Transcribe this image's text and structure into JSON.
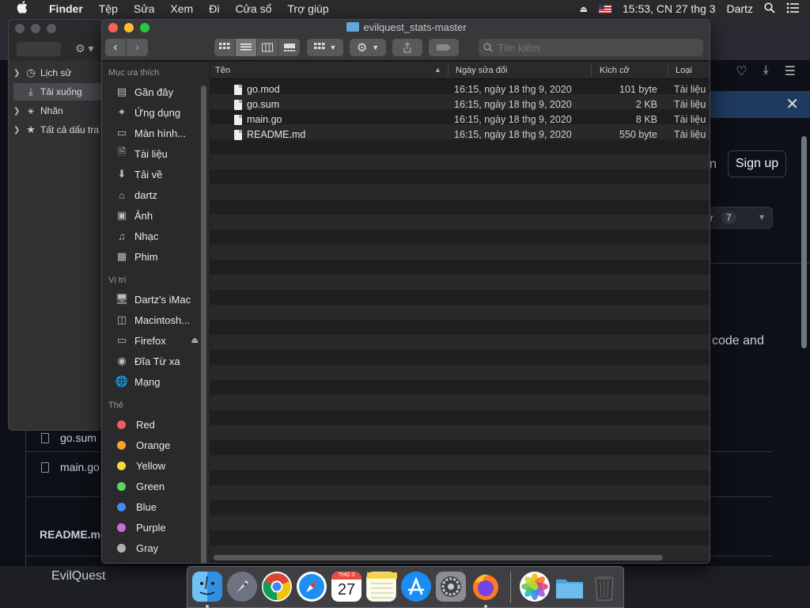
{
  "menubar": {
    "app": "Finder",
    "items": [
      "Tệp",
      "Sửa",
      "Xem",
      "Đi",
      "Cửa sổ",
      "Trợ giúp"
    ],
    "clock": "15:53, CN 27 thg 3",
    "user": "Dartz"
  },
  "browser": {
    "sign_up": "Sign up",
    "fragment_n": "n",
    "star_fragment": "r",
    "star_count": "7",
    "code_and": "code and",
    "files": [
      "go.sum",
      "main.go"
    ],
    "readme": "README.md",
    "evilquest": "EvilQuest"
  },
  "library": {
    "items": [
      {
        "label": "Lịch sử",
        "icon": "clock-icon"
      },
      {
        "label": "Tải xuống",
        "icon": "download-icon"
      },
      {
        "label": "Nhãn",
        "icon": "tag-icon"
      },
      {
        "label": "Tất cả dấu tra",
        "icon": "star-icon"
      }
    ]
  },
  "finder": {
    "title": "evilquest_stats-master",
    "search_placeholder": "Tìm kiếm",
    "sidebar": {
      "favorites_header": "Mục ưa thích",
      "favorites": [
        "Gần đây",
        "Ứng dụng",
        "Màn hình...",
        "Tài liệu",
        "Tải về",
        "dartz",
        "Ảnh",
        "Nhạc",
        "Phim"
      ],
      "locations_header": "Vị trí",
      "locations": [
        "Dartz's iMac",
        "Macintosh...",
        "Firefox",
        "Đĩa Từ xa",
        "Mạng"
      ],
      "tags_header": "Thẻ",
      "tags": [
        {
          "label": "Red",
          "color": "#ec5f5d"
        },
        {
          "label": "Orange",
          "color": "#f5a623"
        },
        {
          "label": "Yellow",
          "color": "#f7d93f"
        },
        {
          "label": "Green",
          "color": "#5dd65d"
        },
        {
          "label": "Blue",
          "color": "#3f8ff0"
        },
        {
          "label": "Purple",
          "color": "#c86be0"
        },
        {
          "label": "Gray",
          "color": "#b0b0b2"
        }
      ]
    },
    "columns": {
      "name": "Tên",
      "date": "Ngày sửa đổi",
      "size": "Kích cỡ",
      "kind": "Loại"
    },
    "files": [
      {
        "name": "go.mod",
        "date": "16:15, ngày 18 thg 9, 2020",
        "size": "101 byte",
        "kind": "Tài liệu"
      },
      {
        "name": "go.sum",
        "date": "16:15, ngày 18 thg 9, 2020",
        "size": "2 KB",
        "kind": "Tài liệu"
      },
      {
        "name": "main.go",
        "date": "16:15, ngày 18 thg 9, 2020",
        "size": "8 KB",
        "kind": "Tài liệu"
      },
      {
        "name": "README.md",
        "date": "16:15, ngày 18 thg 9, 2020",
        "size": "550 byte",
        "kind": "Tài liệu"
      }
    ]
  },
  "dock": {
    "calendar_month": "THG 3",
    "calendar_day": "27",
    "apps": [
      "finder",
      "launchpad",
      "chrome",
      "safari",
      "calendar",
      "notes",
      "app-store",
      "system-preferences",
      "firefox",
      "photos",
      "folder",
      "trash"
    ]
  }
}
